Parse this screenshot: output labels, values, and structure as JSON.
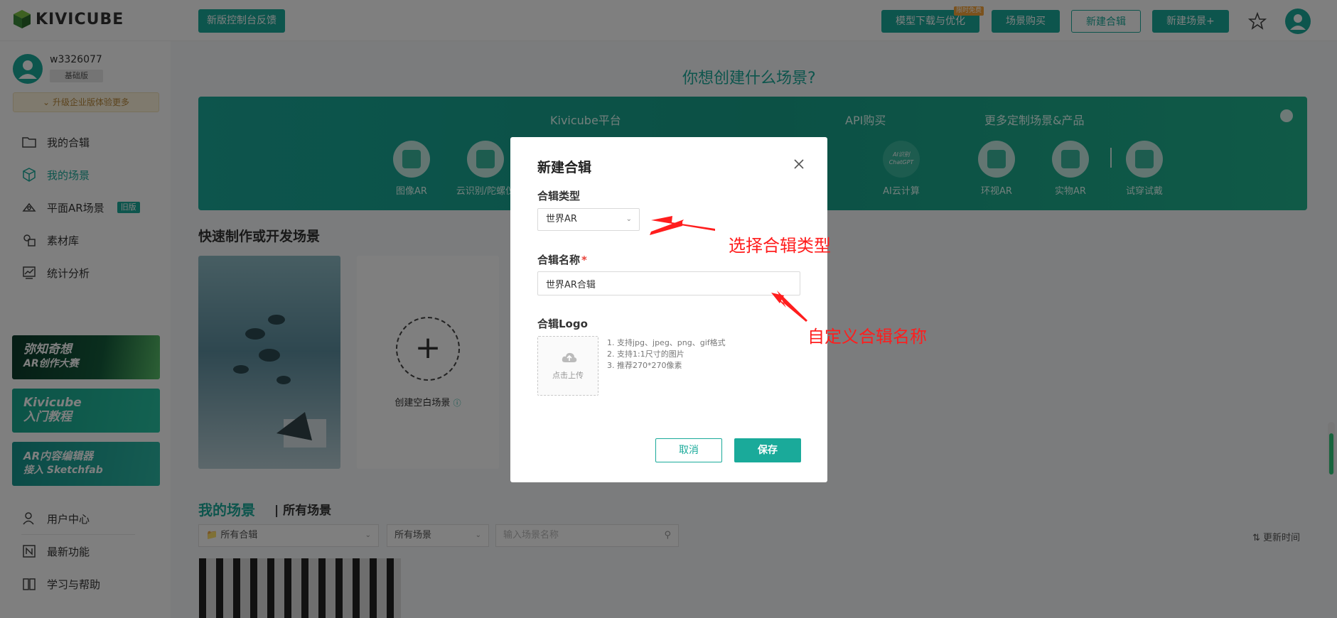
{
  "header": {
    "logo_text": "KIVICUBE",
    "feedback_label": "新版控制台反馈",
    "hot_badge": "限时免费",
    "buttons": [
      {
        "label": "模型下载与优化"
      },
      {
        "label": "场景购买"
      },
      {
        "label": "新建合辑"
      },
      {
        "label": "新建场景+"
      }
    ]
  },
  "sidebar": {
    "username": "w3326077",
    "tier": "基础版",
    "upgrade": "升级企业版体验更多",
    "items": [
      {
        "label": "我的合辑"
      },
      {
        "label": "我的场景"
      },
      {
        "label": "平面AR场景"
      },
      {
        "label": "素材库"
      },
      {
        "label": "统计分析"
      }
    ],
    "old_tag": "旧版",
    "banners": [
      {
        "text_1": "弥知奇想",
        "text_2": "AR创作大赛"
      },
      {
        "text_1": "Kivicube",
        "text_2": "入门教程"
      },
      {
        "text_1": "AR内容编辑器",
        "text_2": "接入 Sketchfab"
      }
    ],
    "bottom_items": [
      {
        "label": "用户中心"
      },
      {
        "label": "最新功能"
      },
      {
        "label": "学习与帮助"
      }
    ]
  },
  "main": {
    "title": "你想创建什么场景?",
    "platform_tabs": [
      "Kivicube平台",
      "API购买",
      "更多定制场景&产品"
    ],
    "platform_items": [
      {
        "label": "图像AR"
      },
      {
        "label": "云识别/陀螺仪"
      },
      {
        "label": "AI云计算",
        "badge": "AI识别ChatGPT"
      },
      {
        "label": "环视AR"
      },
      {
        "label": "实物AR"
      },
      {
        "label": "试穿试戴"
      }
    ],
    "quick_title": "快速制作或开发场景",
    "create_blank": "创建空白场景",
    "my_scenes": "我的场景",
    "all_scenes": "所有场景",
    "filter_collection": "所有合辑",
    "filter_scene": "所有场景",
    "search_placeholder": "输入场景名称",
    "sort_label": "更新时间"
  },
  "modal": {
    "title": "新建合辑",
    "type_label": "合辑类型",
    "type_value": "世界AR",
    "name_label": "合辑名称",
    "name_required": "*",
    "name_value": "世界AR合辑",
    "logo_label": "合辑Logo",
    "upload_text": "点击上传",
    "hints": [
      "1. 支持jpg、jpeg、png、gif格式",
      "2. 支持1:1尺寸的图片",
      "3. 推荐270*270像素"
    ],
    "cancel": "取消",
    "save": "保存"
  },
  "annotations": {
    "select_type": "选择合辑类型",
    "custom_name": "自定义合辑名称"
  },
  "colors": {
    "accent": "#1aaa9a",
    "annotation": "#ff1d1d"
  }
}
